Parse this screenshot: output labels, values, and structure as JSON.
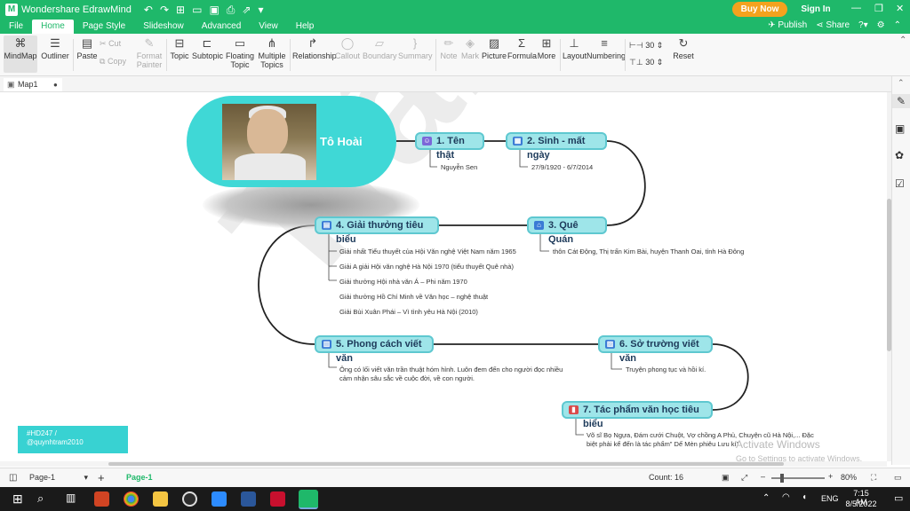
{
  "app": {
    "title": "Wondershare EdrawMind",
    "buy_now": "Buy Now",
    "sign_in": "Sign In"
  },
  "menu": {
    "file": "File",
    "home": "Home",
    "page_style": "Page Style",
    "slideshow": "Slideshow",
    "advanced": "Advanced",
    "view": "View",
    "help": "Help",
    "publish": "Publish",
    "share": "Share"
  },
  "ribbon": {
    "mindmap": "MindMap",
    "outliner": "Outliner",
    "paste": "Paste",
    "cut": "Cut",
    "copy": "Copy",
    "format_painter": "Format Painter",
    "topic": "Topic",
    "subtopic": "Subtopic",
    "floating_topic": "Floating Topic",
    "multiple_topics": "Multiple Topics",
    "relationship": "Relationship",
    "callout": "Callout",
    "boundary": "Boundary",
    "summary": "Summary",
    "note": "Note",
    "mark": "Mark",
    "picture": "Picture",
    "formula": "Formula",
    "more": "More",
    "layout": "Layout",
    "numbering": "Numbering",
    "spacing_h": "30",
    "spacing_v": "30",
    "reset": "Reset"
  },
  "tab": {
    "doc_name": "Map1"
  },
  "map": {
    "root": "Tô Hoài",
    "topics": [
      {
        "label": "1. Tên thật",
        "leaves": [
          "Nguyễn Sen"
        ]
      },
      {
        "label": "2. Sinh - mất ngày",
        "leaves": [
          "27/9/1920 - 6/7/2014"
        ]
      },
      {
        "label": "3. Quê Quán",
        "leaves": [
          "thôn Cát Động, Thị trấn Kim Bài, huyện Thanh Oai, tỉnh Hà Đông"
        ]
      },
      {
        "label": "4. Giải thưởng tiêu biểu",
        "leaves": [
          "Giải nhất Tiểu thuyết của Hội Văn nghệ Việt Nam năm 1965",
          "Giải A giải Hội văn nghệ Hà Nội 1970 (tiểu thuyết Quê nhà)",
          "Giải thưởng Hội nhà văn Á – Phi năm 1970",
          "Giải thưởng Hồ Chí Minh về Văn học – nghệ thuật",
          "Giải Bùi Xuân Phái – Vì tình yêu Hà Nội (2010)"
        ]
      },
      {
        "label": "5. Phong cách viết văn",
        "leaves": [
          "Ông có lối viết văn trần thuật hóm hỉnh. Luôn đem đến cho người đọc nhiều cảm nhận sâu sắc về cuộc đời, về con người."
        ]
      },
      {
        "label": "6. Sở trường viết văn",
        "leaves": [
          "Truyện phong tục và hồi kí."
        ]
      },
      {
        "label": "7. Tác phẩm văn học tiêu biểu",
        "leaves": [
          "Võ sĩ Bọ Ngựa, Đám cưới Chuột, Vợ chồng A Phủ, Chuyện cũ Hà Nội,... Đặc biệt phải kể đến là tác phẩm\" Dế Mèn phiêu Lưu kí\""
        ]
      }
    ],
    "watermark": "Trâm",
    "hashtag_line1": "#HD247 /",
    "hashtag_line2": "@quynhtram2010"
  },
  "activation": {
    "title": "Activate Windows",
    "subtitle": "Go to Settings to activate Windows."
  },
  "status": {
    "page_select": "Page-1",
    "page_tab": "Page-1",
    "count": "Count: 16",
    "zoom": "80%"
  },
  "taskbar": {
    "lang": "ENG",
    "time": "7:15 AM",
    "date": "8/5/2022"
  },
  "colors": {
    "brand": "#1fb86a",
    "node_fill": "#9ee5e9",
    "node_border": "#5ec8d0",
    "root_fill": "#3fd8d6"
  }
}
